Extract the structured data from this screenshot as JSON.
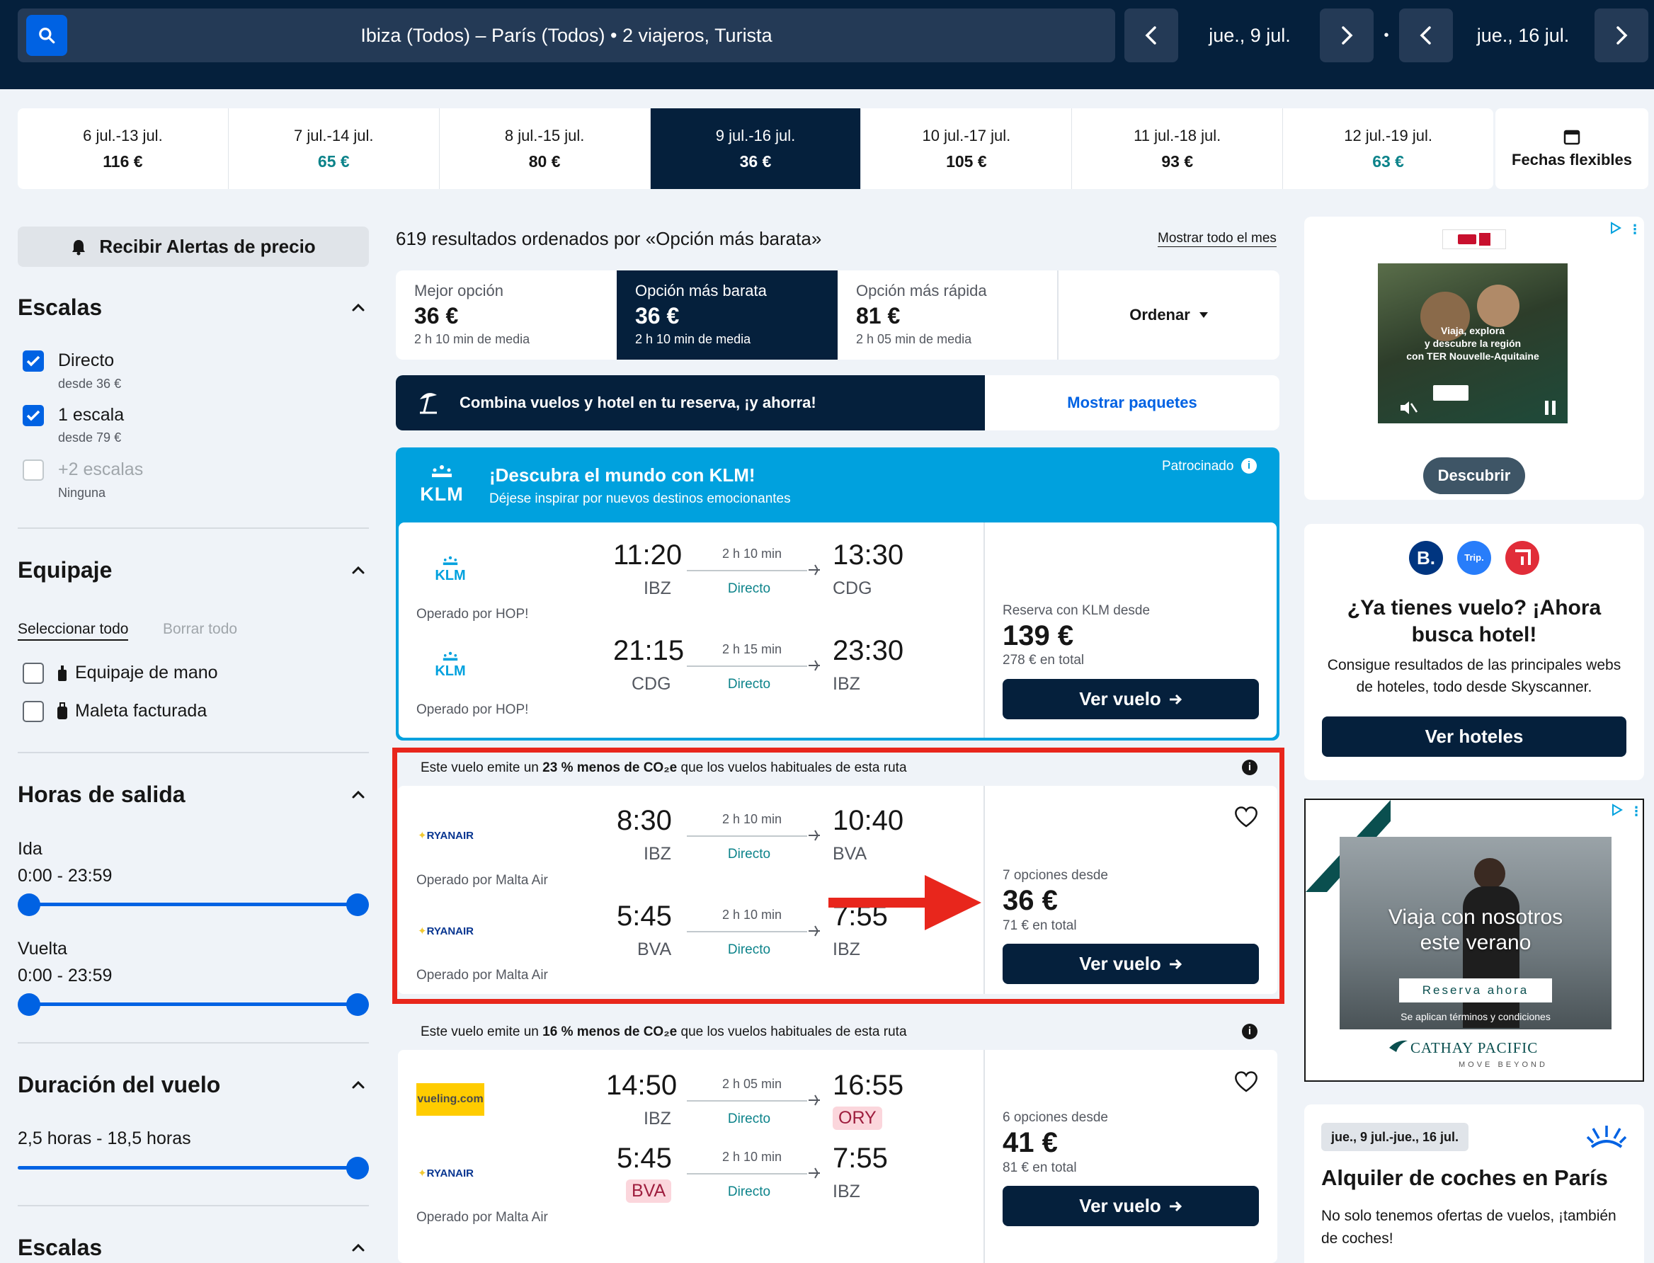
{
  "search": {
    "summary": "Ibiza (Todos) – París (Todos)  •  2 viajeros, Turista",
    "depart_date": "jue., 9 jul.",
    "return_date": "jue., 16 jul.",
    "dot": "•"
  },
  "date_strip": [
    {
      "range": "6 jul.-13 jul.",
      "price": "116 €",
      "cheap": false,
      "selected": false
    },
    {
      "range": "7 jul.-14 jul.",
      "price": "65 €",
      "cheap": true,
      "selected": false
    },
    {
      "range": "8 jul.-15 jul.",
      "price": "80 €",
      "cheap": false,
      "selected": false
    },
    {
      "range": "9 jul.-16 jul.",
      "price": "36 €",
      "cheap": false,
      "selected": true
    },
    {
      "range": "10 jul.-17 jul.",
      "price": "105 €",
      "cheap": false,
      "selected": false
    },
    {
      "range": "11 jul.-18 jul.",
      "price": "93 €",
      "cheap": false,
      "selected": false
    },
    {
      "range": "12 jul.-19 jul.",
      "price": "63 €",
      "cheap": true,
      "selected": false
    }
  ],
  "flexible_dates": "Fechas flexibles",
  "filters": {
    "alert_button": "Recibir Alertas de precio",
    "stops": {
      "title": "Escalas",
      "direct": "Directo",
      "direct_sub": "desde 36 €",
      "one": "1 escala",
      "one_sub": "desde 79 €",
      "two": "+2 escalas",
      "two_sub": "Ninguna"
    },
    "baggage": {
      "title": "Equipaje",
      "select_all": "Seleccionar todo",
      "clear_all": "Borrar todo",
      "carry_on": "Equipaje de mano",
      "checked": "Maleta facturada"
    },
    "times": {
      "title": "Horas de salida",
      "outbound": "Ida",
      "outbound_range": "0:00 - 23:59",
      "return": "Vuelta",
      "return_range": "0:00 - 23:59"
    },
    "duration": {
      "title": "Duración del vuelo",
      "range": "2,5 horas - 18,5 horas"
    },
    "stops2": {
      "title": "Escalas"
    }
  },
  "results": {
    "count_text": "619 resultados ordenados por «Opción más barata»",
    "show_month": "Mostrar todo el mes",
    "sort": [
      {
        "title": "Mejor opción",
        "price": "36 €",
        "sub": "2 h 10 min de media"
      },
      {
        "title": "Opción más barata",
        "price": "36 €",
        "sub": "2 h 10 min de media"
      },
      {
        "title": "Opción más rápida",
        "price": "81 €",
        "sub": "2 h 05 min de media"
      }
    ],
    "sort_button": "Ordenar",
    "combo_text": "Combina vuelos y hotel en tu reserva, ¡y ahorra!",
    "combo_link": "Mostrar paquetes"
  },
  "klm_ad": {
    "title": "¡Descubra el mundo con KLM!",
    "subtitle": "Déjese inspirar por nuevos destinos emocionantes",
    "sponsored": "Patrocinado",
    "logo": "KLM",
    "out": {
      "dep": "11:20",
      "dep_ap": "IBZ",
      "dur": "2 h 10 min",
      "type": "Directo",
      "arr": "13:30",
      "arr_ap": "CDG",
      "op": "Operado por HOP!"
    },
    "ret": {
      "dep": "21:15",
      "dep_ap": "CDG",
      "dur": "2 h 15 min",
      "type": "Directo",
      "arr": "23:30",
      "arr_ap": "IBZ",
      "op": "Operado por HOP!"
    },
    "price_label": "Reserva con KLM desde",
    "price": "139 €",
    "total": "278 € en total",
    "button": "Ver vuelo"
  },
  "flight1": {
    "co2_pre": "Este vuelo emite un ",
    "co2_bold": "23 % menos de CO₂e",
    "co2_post": " que los vuelos habituales de esta ruta",
    "airline_out": "RYANAIR",
    "airline_ret": "RYANAIR",
    "out": {
      "dep": "8:30",
      "dep_ap": "IBZ",
      "dur": "2 h 10 min",
      "type": "Directo",
      "arr": "10:40",
      "arr_ap": "BVA",
      "op": "Operado por Malta Air"
    },
    "ret": {
      "dep": "5:45",
      "dep_ap": "BVA",
      "dur": "2 h 10 min",
      "type": "Directo",
      "arr": "7:55",
      "arr_ap": "IBZ",
      "op": "Operado por Malta Air"
    },
    "price_label": "7 opciones desde",
    "price": "36 €",
    "total": "71 € en total",
    "button": "Ver vuelo"
  },
  "flight2": {
    "co2_pre": "Este vuelo emite un ",
    "co2_bold": "16 % menos de CO₂e",
    "co2_post": " que los vuelos habituales de esta ruta",
    "airline_out": "vueling.com",
    "airline_ret": "RYANAIR",
    "out": {
      "dep": "14:50",
      "dep_ap": "IBZ",
      "dur": "2 h 05 min",
      "type": "Directo",
      "arr": "16:55",
      "arr_ap": "ORY"
    },
    "ret": {
      "dep": "5:45",
      "dep_ap": "BVA",
      "dur": "2 h 10 min",
      "type": "Directo",
      "arr": "7:55",
      "arr_ap": "IBZ",
      "op": "Operado por Malta Air"
    },
    "price_label": "6 opciones desde",
    "price": "41 €",
    "total": "81 € en total",
    "button": "Ver vuelo"
  },
  "ads": {
    "ter": {
      "line1": "Viaja, explora",
      "line2": "y descubre la región",
      "line3": "con TER Nouvelle-Aquitaine",
      "button": "Descubrir"
    },
    "hotel": {
      "title": "¿Ya tienes vuelo? ¡Ahora busca hotel!",
      "body": "Consigue resultados de las principales webs de hoteles, todo desde Skyscanner.",
      "button": "Ver hoteles",
      "logo_b": "B.",
      "logo_trip": "Trip."
    },
    "cathay": {
      "headline1": "Viaja con nosotros",
      "headline2": "este verano",
      "cta": "Reserva ahora",
      "terms": "Se aplican términos y condiciones",
      "brand": "CATHAY PACIFIC",
      "tagline": "MOVE BEYOND"
    },
    "car": {
      "dates": "jue., 9 jul.-jue., 16 jul.",
      "title": "Alquiler de coches en París",
      "body": "No solo tenemos ofertas de vuelos, ¡también de coches!"
    }
  },
  "colors": {
    "navy": "#05203c",
    "blue": "#0062e3",
    "green": "#0c838a",
    "highlight": "#e8261c",
    "klm": "#00a1de"
  }
}
